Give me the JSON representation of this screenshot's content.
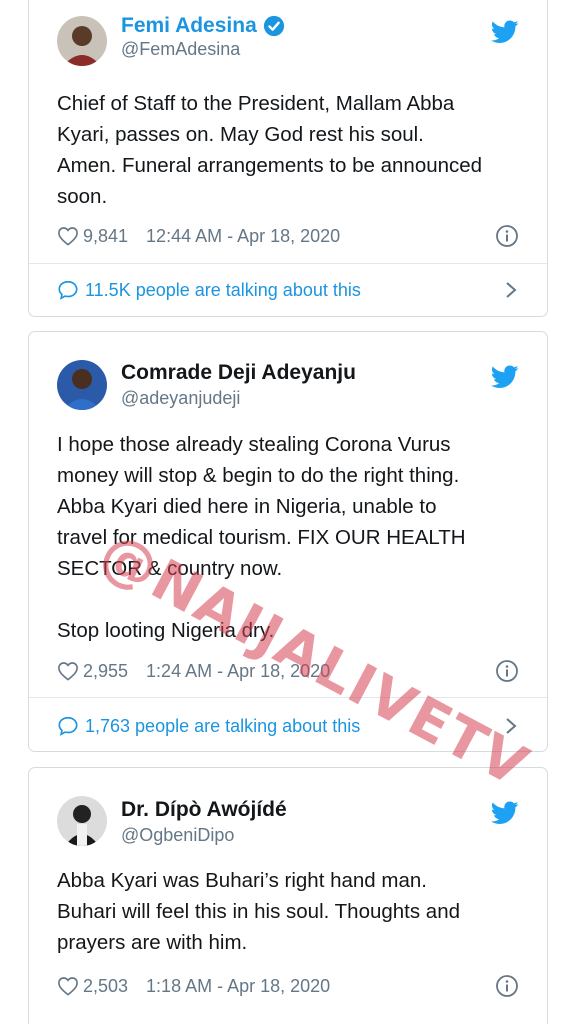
{
  "tweets": [
    {
      "name": "Femi Adesina",
      "handle": "@FemAdesina",
      "verified": true,
      "text": "Chief of Staff to the President, Mallam Abba\nKyari, passes on. May God rest his soul.\nAmen. Funeral arrangements to be announced\nsoon.",
      "likes": "9,841",
      "timestamp": "12:44 AM - Apr 18, 2020",
      "talking": "11.5K people are talking about this"
    },
    {
      "name": "Comrade Deji Adeyanju",
      "handle": "@adeyanjudeji",
      "verified": false,
      "text": "I hope those already stealing Corona Vurus\nmoney will stop & begin to do the right thing.\nAbba Kyari died here in Nigeria, unable to\ntravel for medical tourism. FIX OUR HEALTH\nSECTOR & country now.\n\nStop looting Nigeria dry.",
      "likes": "2,955",
      "timestamp": "1:24 AM - Apr 18, 2020",
      "talking": "1,763 people are talking about this"
    },
    {
      "name": "Dr. Dípò Awójídé",
      "handle": "@OgbeniDipo",
      "verified": false,
      "text": "Abba Kyari was Buhari’s right hand man.\nBuhari will feel this in his soul. Thoughts and\nprayers are with him.",
      "likes": "2,503",
      "timestamp": "1:18 AM - Apr 18, 2020"
    }
  ],
  "watermark": "@NAIJALIVETV",
  "colors": {
    "twitter_blue": "#1b95e0",
    "text": "#14171a",
    "muted": "#657786",
    "border": "#d6dbe0"
  },
  "icons": [
    "verified-badge-icon",
    "twitter-bird-icon",
    "heart-icon",
    "info-icon",
    "speech-bubble-icon",
    "chevron-right-icon"
  ]
}
